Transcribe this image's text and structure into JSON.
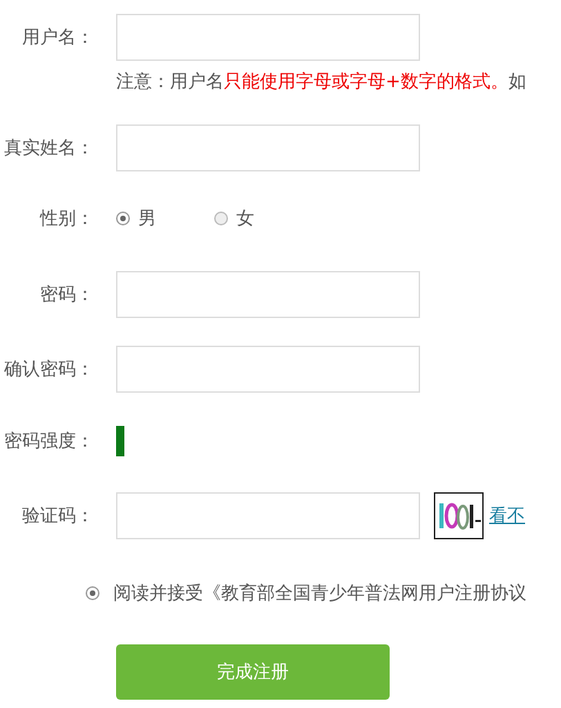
{
  "fields": [
    {
      "kind": "text",
      "label": "用户名：",
      "note": {
        "prefix": "注意：用户名",
        "warning": "只能使用字母或字母+数字的格式。",
        "suffix": "如"
      }
    },
    {
      "kind": "text",
      "label": "真实姓名："
    },
    {
      "kind": "radio",
      "label": "性别：",
      "options": [
        {
          "label": "男",
          "selected": true
        },
        {
          "label": "女",
          "selected": false
        }
      ]
    },
    {
      "kind": "text",
      "label": "密码："
    },
    {
      "kind": "text",
      "label": "确认密码："
    },
    {
      "kind": "meter",
      "label": "密码强度："
    },
    {
      "kind": "captcha",
      "label": "验证码：",
      "link": "看不"
    }
  ],
  "agreement": {
    "text": "阅读并接受《教育部全国青少年普法网用户注册协议",
    "checked": true
  },
  "submit": "完成注册"
}
